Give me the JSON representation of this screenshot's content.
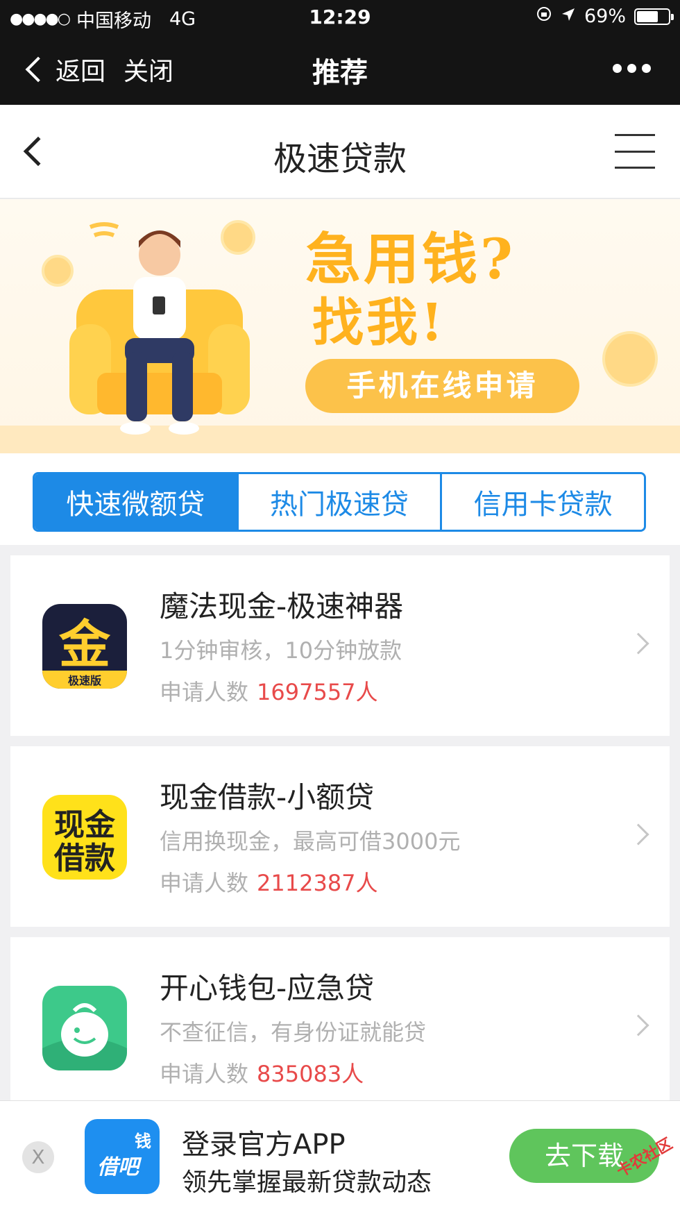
{
  "status_bar": {
    "signal": "●●●●○",
    "carrier": "中国移动",
    "network": "4G",
    "time": "12:29",
    "battery": "69%",
    "battery_level": 0.69
  },
  "wechat_nav": {
    "back_label": "返回",
    "close_label": "关闭",
    "title": "推荐"
  },
  "page_header": {
    "title": "极速贷款"
  },
  "banner": {
    "headline": "急用钱?",
    "subline": "找我!",
    "pill": "手机在线申请"
  },
  "tabs": [
    {
      "label": "快速微额贷",
      "active": true
    },
    {
      "label": "热门极速贷",
      "active": false
    },
    {
      "label": "信用卡贷款",
      "active": false
    }
  ],
  "loans": [
    {
      "name": "魔法现金-极速神器",
      "desc": "1分钟审核，10分钟放款",
      "count_label": "申请人数",
      "count": "1697557人",
      "icon_text": "金",
      "icon_sub": "极速版"
    },
    {
      "name": "现金借款-小额贷",
      "desc": "信用换现金，最高可借3000元",
      "count_label": "申请人数",
      "count": "2112387人",
      "icon_text": "现金借款"
    },
    {
      "name": "开心钱包-应急贷",
      "desc": "不查征信，有身份证就能贷",
      "count_label": "申请人数",
      "count": "835083人"
    }
  ],
  "promo": {
    "close": "X",
    "logo_top": "钱",
    "logo_main": "借吧",
    "title": "登录官方APP",
    "subtitle": "领先掌握最新贷款动态",
    "button": "去下载"
  },
  "watermark": "卡农社区",
  "colors": {
    "accent": "#1d8ae6",
    "count_red": "#e84a4a",
    "download_green": "#5fc55c",
    "banner_orange": "#ffb21e"
  }
}
